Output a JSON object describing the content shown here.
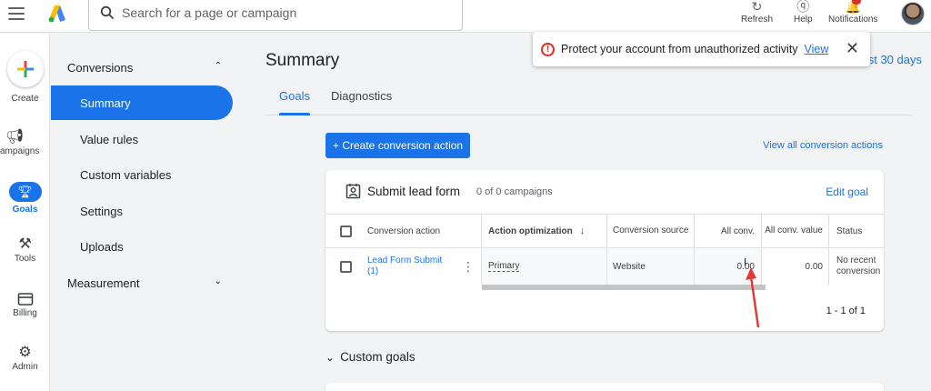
{
  "topbar": {
    "search_placeholder": "Search for a page or campaign",
    "actions": [
      {
        "label": "Refresh",
        "icon": "refresh-icon"
      },
      {
        "label": "Help",
        "icon": "help-icon"
      },
      {
        "label": "Notifications",
        "icon": "bell-icon"
      }
    ]
  },
  "rail": {
    "items": [
      {
        "label": "Create",
        "icon": "plus-icon"
      },
      {
        "label": "ampaigns",
        "icon": "megaphone-icon"
      },
      {
        "label": "Goals",
        "icon": "trophy-icon"
      },
      {
        "label": "Tools",
        "icon": "tools-icon"
      },
      {
        "label": "Billing",
        "icon": "card-icon"
      },
      {
        "label": "Admin",
        "icon": "gear-icon"
      }
    ]
  },
  "subnav": {
    "section": "Conversions",
    "items": [
      "Summary",
      "Value rules",
      "Custom variables",
      "Settings",
      "Uploads"
    ],
    "section2": "Measurement"
  },
  "main": {
    "title": "Summary",
    "tabs": [
      "Goals",
      "Diagnostics"
    ],
    "date_range": "ast 30 days",
    "create_button": "+ Create conversion action",
    "view_all": "View all conversion actions"
  },
  "alert": {
    "text": "Protect your account from unauthorized activity",
    "link": "View"
  },
  "card": {
    "title": "Submit lead form",
    "subtitle": "0 of 0 campaigns",
    "edit": "Edit goal",
    "columns": {
      "action": "Conversion action",
      "optimization": "Action optimization",
      "source": "Conversion source",
      "all_conv": "All conv.",
      "all_conv_value": "All conv. value",
      "status": "Status"
    },
    "row": {
      "action": "Lead Form Submit (1)",
      "optimization": "Primary",
      "source": "Website",
      "all_conv": "0.00",
      "all_conv_value": "0.00",
      "status": "No recent conversion"
    },
    "pager": "1 - 1 of 1"
  },
  "custom_goals": "Custom goals",
  "colors": {
    "accent": "#1a73e8",
    "alert": "#d93025",
    "annotation": "#e53935"
  }
}
